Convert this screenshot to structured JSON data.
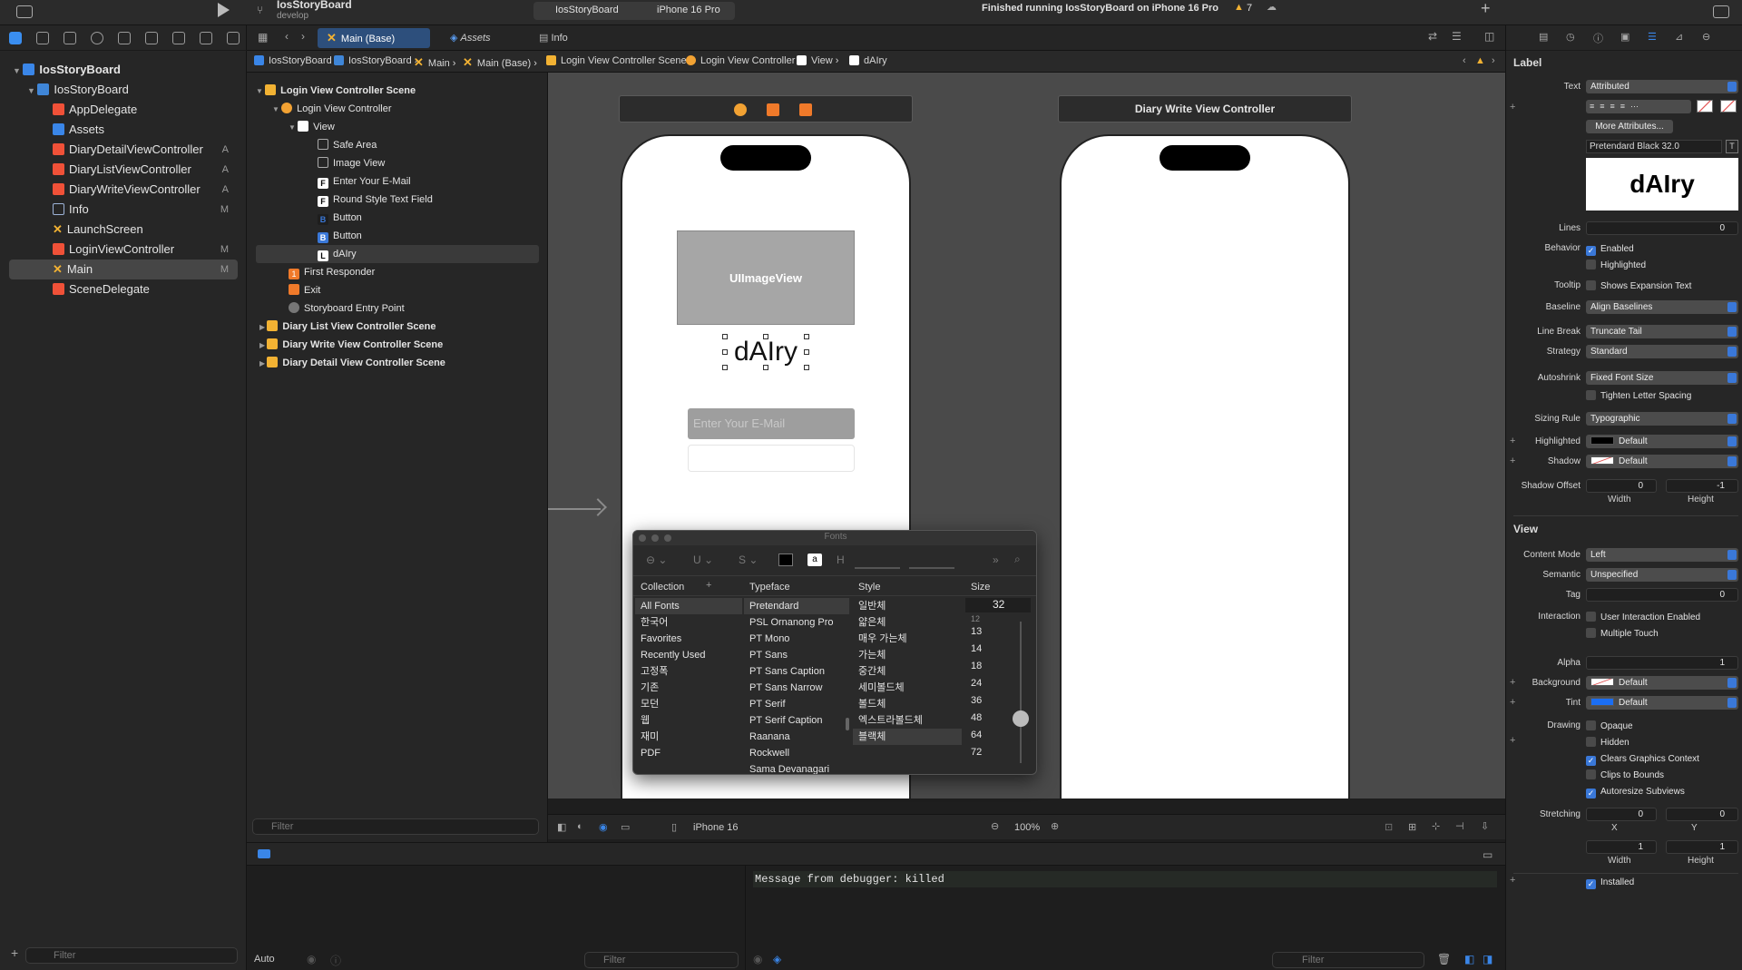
{
  "toolbar": {
    "project": "IosStoryBoard",
    "branch": "develop",
    "scheme": "IosStoryBoard",
    "device": "iPhone 16 Pro",
    "status": "Finished running IosStoryBoard on iPhone 16 Pro",
    "warning_count": "7"
  },
  "navigator": {
    "items": [
      {
        "label": "IosStoryBoard",
        "badge": ""
      },
      {
        "label": "IosStoryBoard",
        "badge": ""
      },
      {
        "label": "AppDelegate",
        "badge": ""
      },
      {
        "label": "Assets",
        "badge": ""
      },
      {
        "label": "DiaryDetailViewController",
        "badge": "A"
      },
      {
        "label": "DiaryListViewController",
        "badge": "A"
      },
      {
        "label": "DiaryWriteViewController",
        "badge": "A"
      },
      {
        "label": "Info",
        "badge": "M"
      },
      {
        "label": "LaunchScreen",
        "badge": ""
      },
      {
        "label": "LoginViewController",
        "badge": "M"
      },
      {
        "label": "Main",
        "badge": "M"
      },
      {
        "label": "SceneDelegate",
        "badge": ""
      }
    ],
    "filter_placeholder": "Filter"
  },
  "tabs": [
    {
      "label": "Main (Base)"
    },
    {
      "label": "Assets"
    },
    {
      "label": "Info"
    }
  ],
  "jumpbar": [
    "IosStoryBoard",
    "IosStoryBoard",
    "Main",
    "Main (Base)",
    "Login View Controller Scene",
    "Login View Controller",
    "View",
    "dAIry"
  ],
  "outline": {
    "items": [
      {
        "label": "Login View Controller Scene"
      },
      {
        "label": "Login View Controller"
      },
      {
        "label": "View"
      },
      {
        "label": "Safe Area"
      },
      {
        "label": "Image View"
      },
      {
        "label": "Enter Your E-Mail"
      },
      {
        "label": "Round Style Text Field"
      },
      {
        "label": "Button"
      },
      {
        "label": "Button"
      },
      {
        "label": "dAIry"
      },
      {
        "label": "First Responder"
      },
      {
        "label": "Exit"
      },
      {
        "label": "Storyboard Entry Point"
      },
      {
        "label": "Diary List View Controller Scene"
      },
      {
        "label": "Diary Write View Controller Scene"
      },
      {
        "label": "Diary Detail View Controller Scene"
      }
    ],
    "filter_placeholder": "Filter"
  },
  "canvas": {
    "scene2_title": "Diary Write View Controller",
    "image_view_label": "UIImageView",
    "title_label": "dAIry",
    "email_placeholder": "Enter Your E-Mail",
    "device": "iPhone 16",
    "zoom": "100%"
  },
  "fontpanel": {
    "title": "Fonts",
    "headers": {
      "collection": "Collection",
      "typeface": "Typeface",
      "style": "Style",
      "size": "Size"
    },
    "collections": [
      "All Fonts",
      "한국어",
      "Favorites",
      "Recently Used",
      "고정폭",
      "기존",
      "모던",
      "웹",
      "재미",
      "PDF"
    ],
    "typefaces": [
      "Pretendard",
      "PSL Ornanong Pro",
      "PT Mono",
      "PT Sans",
      "PT Sans Caption",
      "PT Sans Narrow",
      "PT Serif",
      "PT Serif Caption",
      "Raanana",
      "Rockwell",
      "Sama Devanagari"
    ],
    "styles": [
      "일반체",
      "얇은체",
      "매우 가는체",
      "가는체",
      "중간체",
      "세미볼드체",
      "볼드체",
      "엑스트라볼드체",
      "블랙체"
    ],
    "size_value": "32",
    "sizes": [
      "12",
      "13",
      "14",
      "18",
      "24",
      "36",
      "48",
      "64",
      "72"
    ]
  },
  "console": {
    "message": "Message from debugger: killed",
    "mode": "Auto",
    "filter_placeholder": "Filter"
  },
  "inspector": {
    "label_section": "Label",
    "text_label": "Text",
    "text_value": "Attributed",
    "more_attributes": "More Attributes...",
    "font_value": "Pretendard Black 32.0",
    "preview_text": "dAIry",
    "lines_label": "Lines",
    "lines_value": "0",
    "behavior_label": "Behavior",
    "enabled": "Enabled",
    "highlighted": "Highlighted",
    "tooltip_label": "Tooltip",
    "tooltip_value": "Shows Expansion Text",
    "baseline_label": "Baseline",
    "baseline_value": "Align Baselines",
    "linebreak_label": "Line Break",
    "linebreak_value": "Truncate Tail",
    "strategy_label": "Strategy",
    "strategy_value": "Standard",
    "autoshrink_label": "Autoshrink",
    "autoshrink_value": "Fixed Font Size",
    "tighten": "Tighten Letter Spacing",
    "sizing_label": "Sizing Rule",
    "sizing_value": "Typographic",
    "highlighted_label": "Highlighted",
    "highlighted_value": "Default",
    "shadow_label": "Shadow",
    "shadow_value": "Default",
    "shadow_offset_label": "Shadow Offset",
    "shadow_w": "0",
    "shadow_h": "-1",
    "width": "Width",
    "height": "Height",
    "view_section": "View",
    "content_mode_label": "Content Mode",
    "content_mode_value": "Left",
    "semantic_label": "Semantic",
    "semantic_value": "Unspecified",
    "tag_label": "Tag",
    "tag_value": "0",
    "interaction_label": "Interaction",
    "user_interaction": "User Interaction Enabled",
    "multiple_touch": "Multiple Touch",
    "alpha_label": "Alpha",
    "alpha_value": "1",
    "background_label": "Background",
    "background_value": "Default",
    "tint_label": "Tint",
    "tint_value": "Default",
    "drawing_label": "Drawing",
    "opaque": "Opaque",
    "hidden": "Hidden",
    "clears": "Clears Graphics Context",
    "clips": "Clips to Bounds",
    "autoresize": "Autoresize Subviews",
    "stretching_label": "Stretching",
    "stretch_x": "0",
    "stretch_y": "0",
    "x": "X",
    "y": "Y",
    "stretch_w": "1",
    "stretch_h": "1",
    "installed": "Installed"
  }
}
